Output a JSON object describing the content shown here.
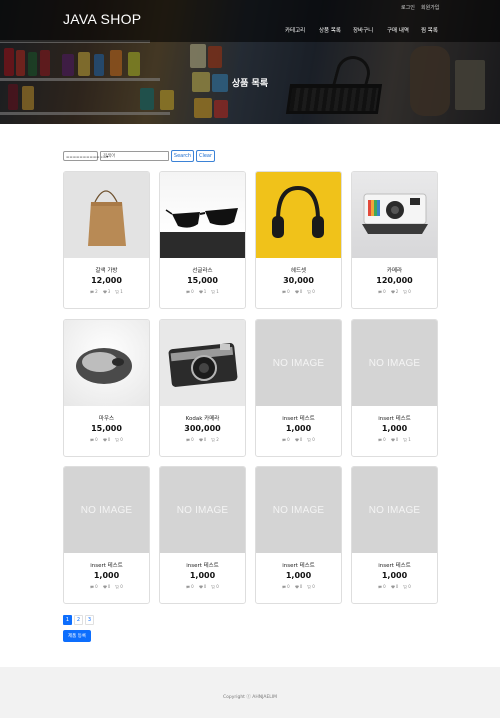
{
  "header": {
    "brand": "JAVA SHOP",
    "util_links": [
      "로그인",
      "회원가입"
    ],
    "nav": [
      "카테고리",
      "상품 목록",
      "장바구니",
      "구매 내역",
      "찜 목록"
    ],
    "hero_title": "상품 목록"
  },
  "search": {
    "select_value": "============",
    "input_placeholder": "검색어",
    "search_label": "Search",
    "clear_label": "Clear"
  },
  "products": [
    {
      "name": "갈색 가방",
      "price": "12,000",
      "image": "tote-bag",
      "comments": "2",
      "likes": "3",
      "carts": "1"
    },
    {
      "name": "선글라스",
      "price": "15,000",
      "image": "sunglasses",
      "comments": "0",
      "likes": "1",
      "carts": "1"
    },
    {
      "name": "헤드셋",
      "price": "30,000",
      "image": "headphones",
      "comments": "0",
      "likes": "0",
      "carts": "0"
    },
    {
      "name": "카메라",
      "price": "120,000",
      "image": "instant-camera",
      "comments": "0",
      "likes": "2",
      "carts": "0"
    },
    {
      "name": "마우스",
      "price": "15,000",
      "image": "mouse",
      "comments": "0",
      "likes": "0",
      "carts": "0"
    },
    {
      "name": "Kodak 카메라",
      "price": "300,000",
      "image": "kodak-camera",
      "comments": "0",
      "likes": "0",
      "carts": "2"
    },
    {
      "name": "insert 테스트",
      "price": "1,000",
      "image": "NO IMAGE",
      "comments": "0",
      "likes": "0",
      "carts": "0"
    },
    {
      "name": "insert 테스트",
      "price": "1,000",
      "image": "NO IMAGE",
      "comments": "0",
      "likes": "0",
      "carts": "1"
    },
    {
      "name": "insert 테스트",
      "price": "1,000",
      "image": "NO IMAGE",
      "comments": "0",
      "likes": "0",
      "carts": "0"
    },
    {
      "name": "insert 테스트",
      "price": "1,000",
      "image": "NO IMAGE",
      "comments": "0",
      "likes": "0",
      "carts": "0"
    },
    {
      "name": "insert 테스트",
      "price": "1,000",
      "image": "NO IMAGE",
      "comments": "0",
      "likes": "0",
      "carts": "0"
    },
    {
      "name": "insert 테스트",
      "price": "1,000",
      "image": "NO IMAGE",
      "comments": "0",
      "likes": "0",
      "carts": "0"
    }
  ],
  "icons": {
    "comment": "chat-bubble-icon",
    "like": "heart-icon",
    "cart": "cart-icon"
  },
  "pagination": {
    "pages": [
      "1",
      "2",
      "3"
    ],
    "current": "1"
  },
  "register_label": "제품 등록",
  "footer": {
    "copyright": "Copyright ⓒ AHNJAELIM"
  },
  "colors": {
    "primary": "#0d6efd",
    "placeholder_bg": "#d4d4d4",
    "footer_bg": "#f2f2f2"
  }
}
